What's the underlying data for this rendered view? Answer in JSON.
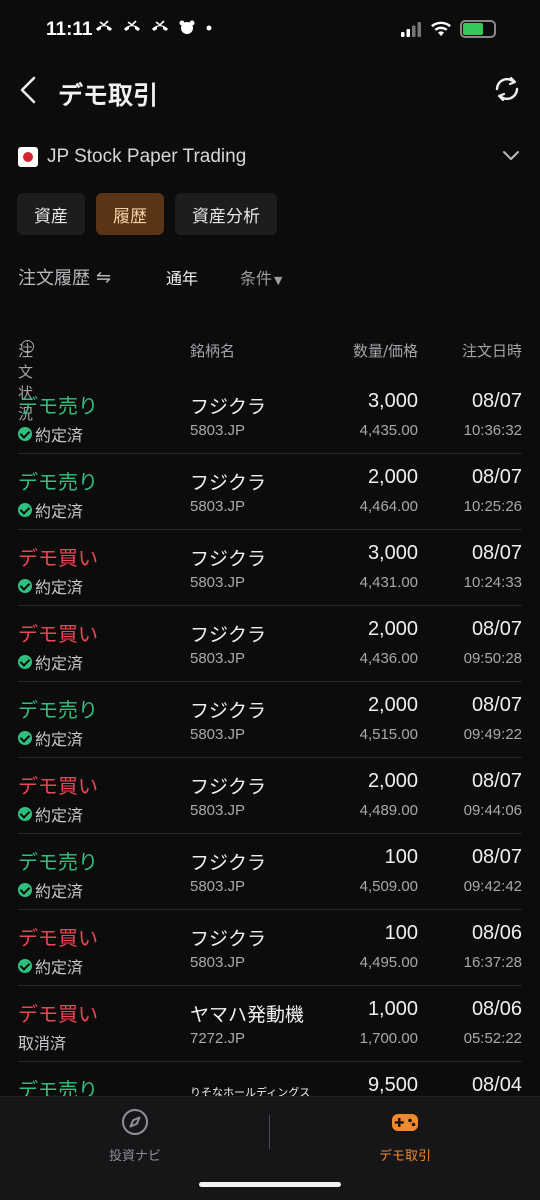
{
  "status_bar": {
    "time": "11:11",
    "notif_icons": [
      "missed-call-icon",
      "missed-call-icon",
      "missed-call-icon",
      "app-icon"
    ],
    "battery_color": "#34c759"
  },
  "header": {
    "title": "デモ取引"
  },
  "account": {
    "name": "JP Stock Paper Trading"
  },
  "tabs": [
    {
      "label": "資産",
      "active": false
    },
    {
      "label": "履歴",
      "active": true
    },
    {
      "label": "資産分析",
      "active": false
    }
  ],
  "filters": {
    "title": "注文履歴",
    "period": "通年",
    "condition": "条件"
  },
  "columns": {
    "status": "注文状況",
    "name": "銘柄名",
    "qty_price": "数量/価格",
    "datetime": "注文日時"
  },
  "orders": [
    {
      "side": "デモ売り",
      "side_type": "sell",
      "status": "約定済",
      "filled": true,
      "name": "フジクラ",
      "code": "5803.JP",
      "qty": "3,000",
      "price": "4,435.00",
      "date": "08/07",
      "time": "10:36:32"
    },
    {
      "side": "デモ売り",
      "side_type": "sell",
      "status": "約定済",
      "filled": true,
      "name": "フジクラ",
      "code": "5803.JP",
      "qty": "2,000",
      "price": "4,464.00",
      "date": "08/07",
      "time": "10:25:26"
    },
    {
      "side": "デモ買い",
      "side_type": "buy",
      "status": "約定済",
      "filled": true,
      "name": "フジクラ",
      "code": "5803.JP",
      "qty": "3,000",
      "price": "4,431.00",
      "date": "08/07",
      "time": "10:24:33"
    },
    {
      "side": "デモ買い",
      "side_type": "buy",
      "status": "約定済",
      "filled": true,
      "name": "フジクラ",
      "code": "5803.JP",
      "qty": "2,000",
      "price": "4,436.00",
      "date": "08/07",
      "time": "09:50:28"
    },
    {
      "side": "デモ売り",
      "side_type": "sell",
      "status": "約定済",
      "filled": true,
      "name": "フジクラ",
      "code": "5803.JP",
      "qty": "2,000",
      "price": "4,515.00",
      "date": "08/07",
      "time": "09:49:22"
    },
    {
      "side": "デモ買い",
      "side_type": "buy",
      "status": "約定済",
      "filled": true,
      "name": "フジクラ",
      "code": "5803.JP",
      "qty": "2,000",
      "price": "4,489.00",
      "date": "08/07",
      "time": "09:44:06"
    },
    {
      "side": "デモ売り",
      "side_type": "sell",
      "status": "約定済",
      "filled": true,
      "name": "フジクラ",
      "code": "5803.JP",
      "qty": "100",
      "price": "4,509.00",
      "date": "08/07",
      "time": "09:42:42"
    },
    {
      "side": "デモ買い",
      "side_type": "buy",
      "status": "約定済",
      "filled": true,
      "name": "フジクラ",
      "code": "5803.JP",
      "qty": "100",
      "price": "4,495.00",
      "date": "08/06",
      "time": "16:37:28"
    },
    {
      "side": "デモ買い",
      "side_type": "buy",
      "status": "取消済",
      "filled": false,
      "name": "ヤマハ発動機",
      "code": "7272.JP",
      "qty": "1,000",
      "price": "1,700.00",
      "date": "08/06",
      "time": "05:52:22"
    },
    {
      "side": "デモ売り",
      "side_type": "sell",
      "status": "",
      "filled": false,
      "name": "りそなホールディングス",
      "code": "",
      "qty": "9,500",
      "price": "",
      "date": "08/04",
      "time": ""
    }
  ],
  "bottom_nav": [
    {
      "label": "投資ナビ",
      "icon": "compass-icon",
      "active": false
    },
    {
      "label": "デモ取引",
      "icon": "gamepad-icon",
      "active": true
    }
  ],
  "colors": {
    "sell": "#2fc07f",
    "buy": "#ec4554",
    "accent": "#f28a2b",
    "active_tab_bg": "#5a3414"
  }
}
